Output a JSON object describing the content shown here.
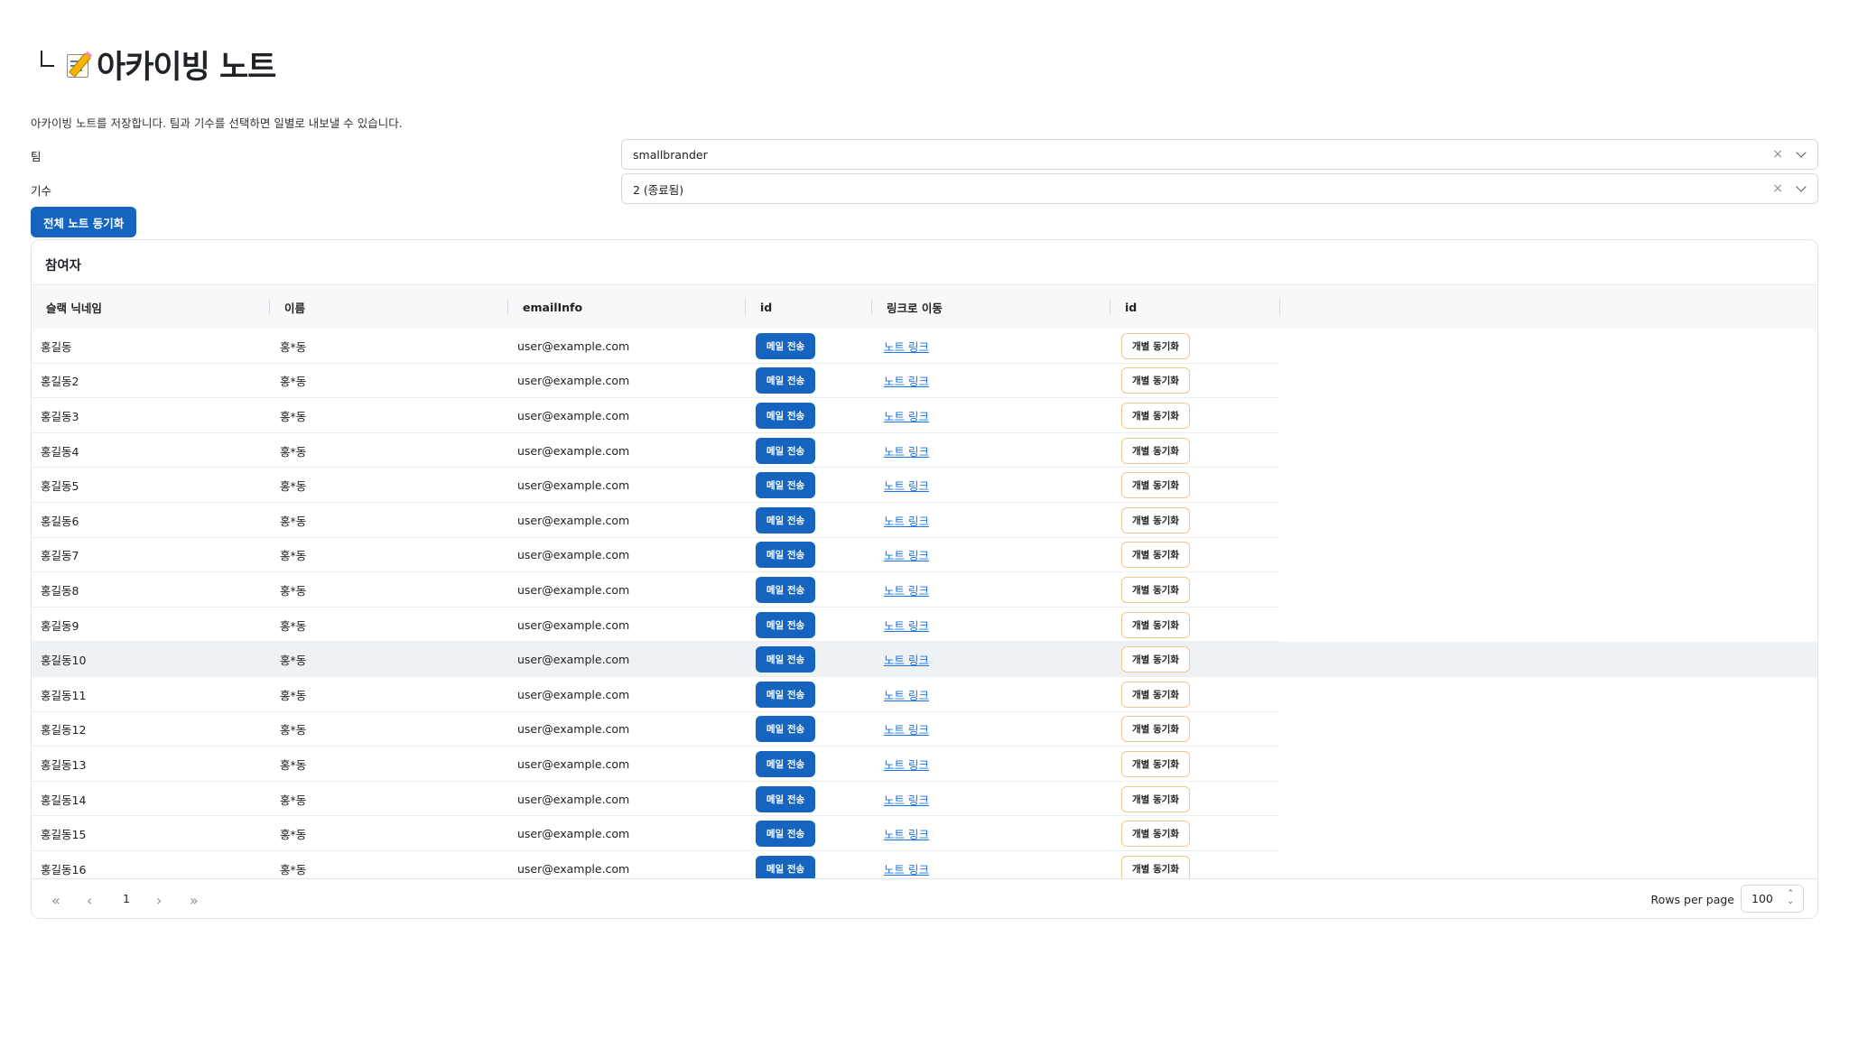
{
  "page": {
    "title": "아카이빙 노트",
    "description": "아카이빙 노트를 저장합니다. 팀과 기수를 선택하면 일별로 내보낼 수 있습니다."
  },
  "filters": {
    "team_label": "팀",
    "team_value": "smallbrander",
    "cohort_label": "기수",
    "cohort_value": "2 (종료됨)"
  },
  "sync_all_label": "전체 노트 동기화",
  "table": {
    "title": "참여자",
    "headers": [
      "슬랙 닉네임",
      "이름",
      "emailInfo",
      "id",
      "링크로 이동",
      "id"
    ],
    "mail_label": "메일 전송",
    "link_label": "노트 링크",
    "sync_label": "개별 동기화",
    "rows": [
      {
        "nick": "홍길동",
        "name": "홍*동",
        "email": "user@example.com"
      },
      {
        "nick": "홍길동2",
        "name": "홍*동",
        "email": "user@example.com"
      },
      {
        "nick": "홍길동3",
        "name": "홍*동",
        "email": "user@example.com"
      },
      {
        "nick": "홍길동4",
        "name": "홍*동",
        "email": "user@example.com"
      },
      {
        "nick": "홍길동5",
        "name": "홍*동",
        "email": "user@example.com"
      },
      {
        "nick": "홍길동6",
        "name": "홍*동",
        "email": "user@example.com"
      },
      {
        "nick": "홍길동7",
        "name": "홍*동",
        "email": "user@example.com"
      },
      {
        "nick": "홍길동8",
        "name": "홍*동",
        "email": "user@example.com"
      },
      {
        "nick": "홍길동9",
        "name": "홍*동",
        "email": "user@example.com"
      },
      {
        "nick": "홍길동10",
        "name": "홍*동",
        "email": "user@example.com"
      },
      {
        "nick": "홍길동11",
        "name": "홍*동",
        "email": "user@example.com"
      },
      {
        "nick": "홍길동12",
        "name": "홍*동",
        "email": "user@example.com"
      },
      {
        "nick": "홍길동13",
        "name": "홍*동",
        "email": "user@example.com"
      },
      {
        "nick": "홍길동14",
        "name": "홍*동",
        "email": "user@example.com"
      },
      {
        "nick": "홍길동15",
        "name": "홍*동",
        "email": "user@example.com"
      },
      {
        "nick": "홍길동16",
        "name": "홍*동",
        "email": "user@example.com"
      }
    ]
  },
  "pagination": {
    "page": "1",
    "rows_per_page_label": "Rows per page",
    "rows_per_page": "100"
  },
  "colors": {
    "primary": "#1565c0",
    "link": "#1a73e8",
    "sync_border": "#f0c690",
    "highlight_row": "#eff2f5"
  }
}
